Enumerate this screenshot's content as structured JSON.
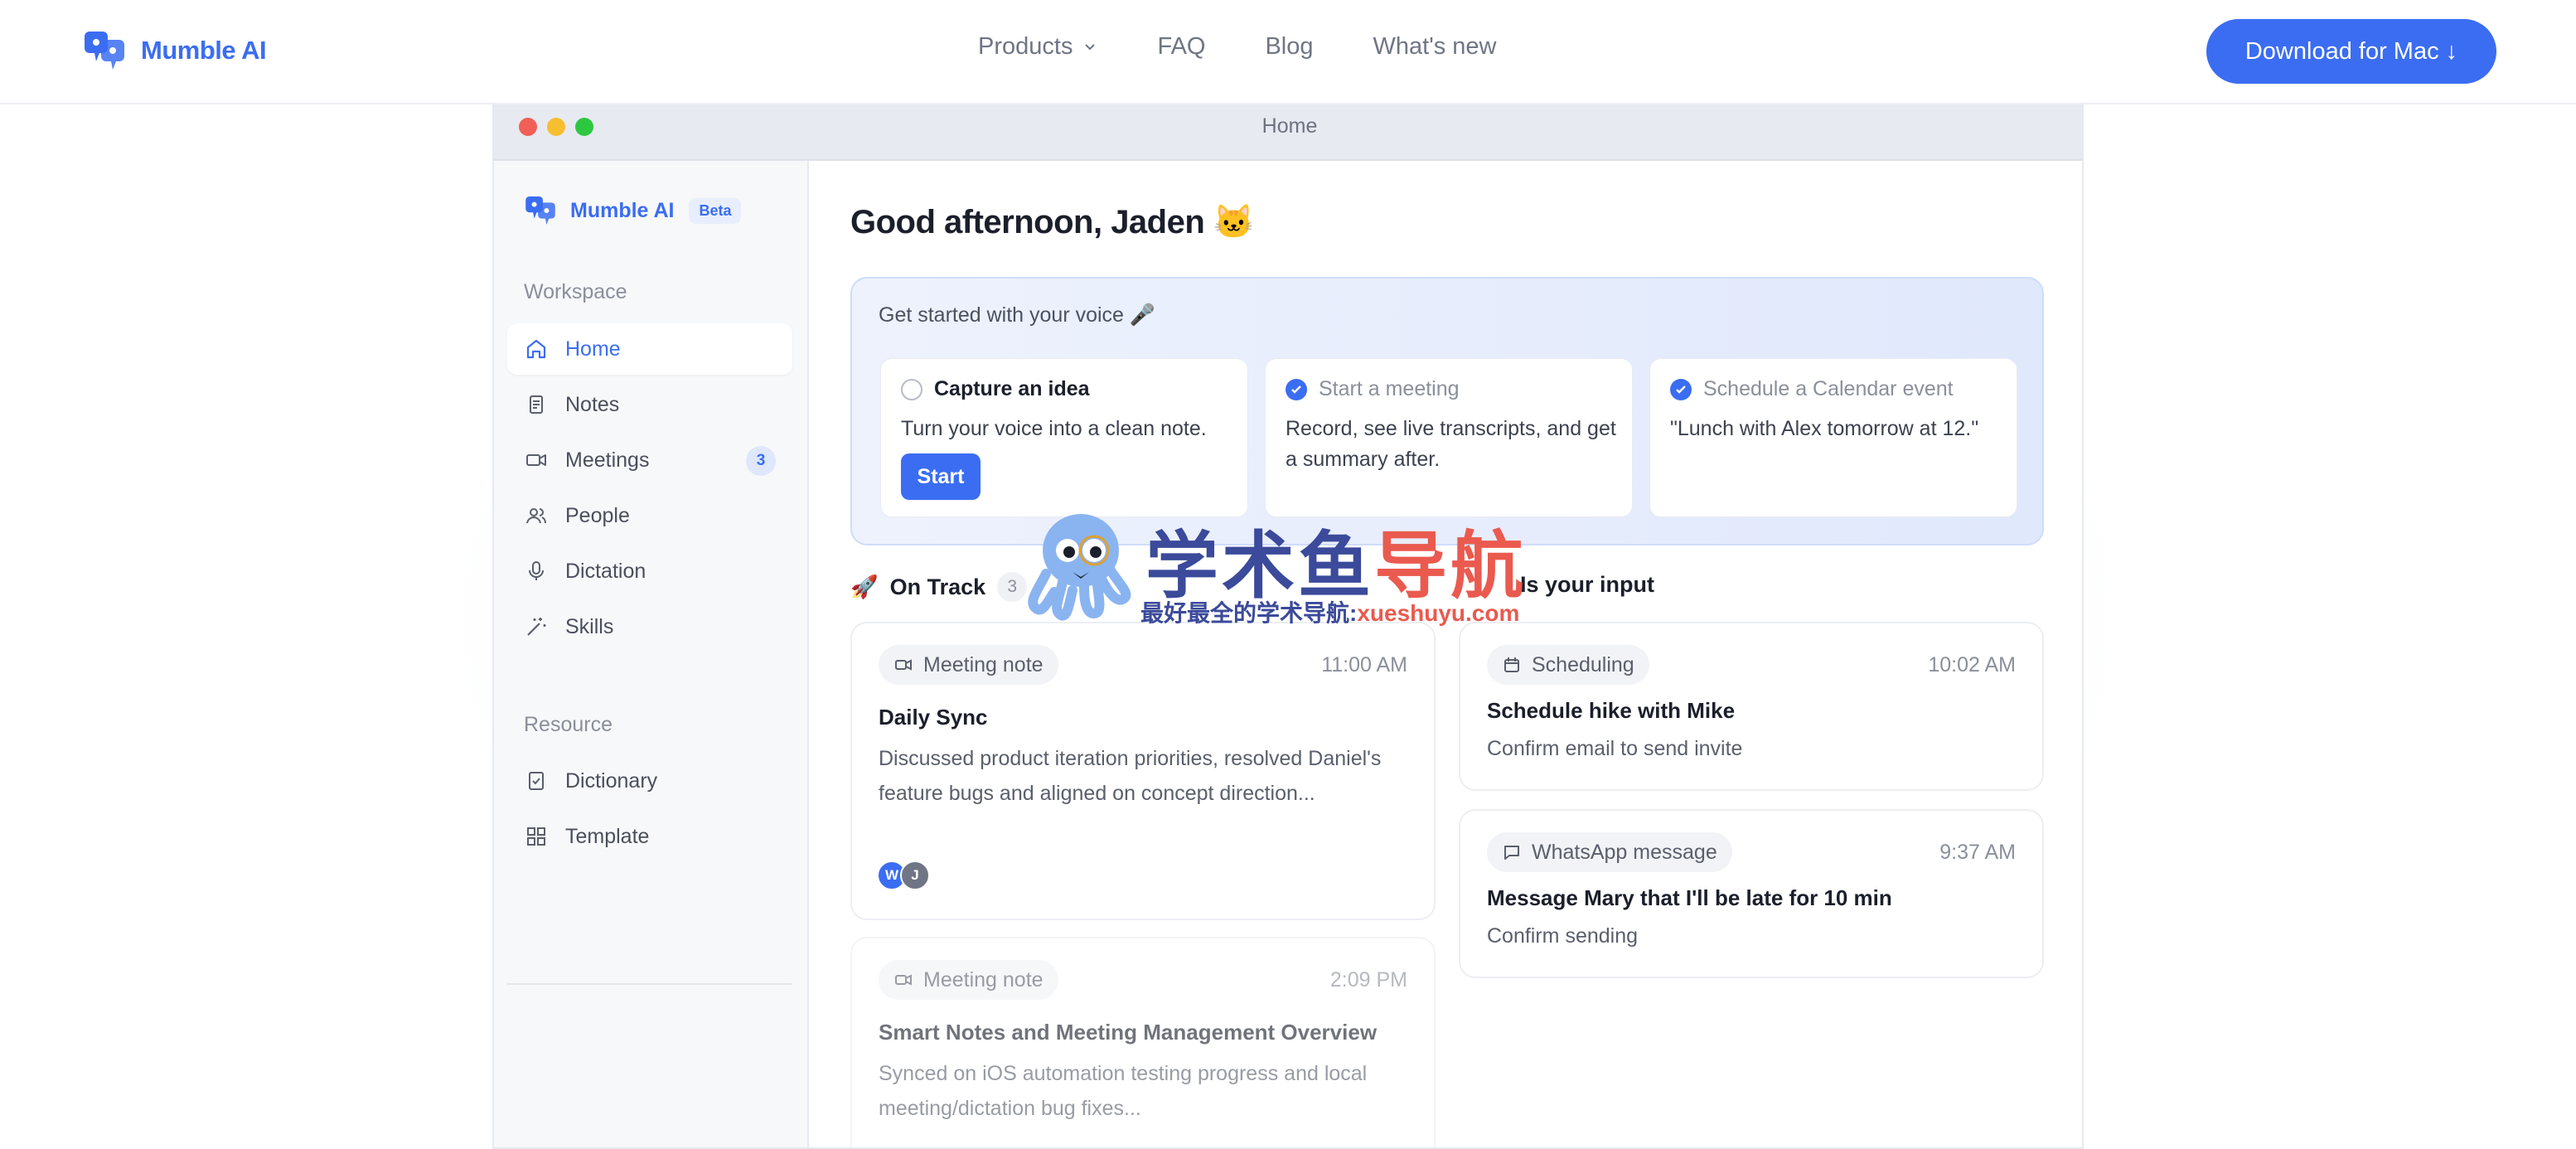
{
  "nav": {
    "brand": "Mumble AI",
    "products": "Products",
    "faq": "FAQ",
    "blog": "Blog",
    "whats_new": "What's new",
    "download": "Download for Mac ↓"
  },
  "window": {
    "title": "Home"
  },
  "sidebar": {
    "brand": "Mumble AI",
    "beta": "Beta",
    "workspace_label": "Workspace",
    "items": [
      {
        "label": "Home",
        "icon": "home-icon"
      },
      {
        "label": "Notes",
        "icon": "note-icon"
      },
      {
        "label": "Meetings",
        "icon": "video-icon",
        "badge": "3"
      },
      {
        "label": "People",
        "icon": "people-icon"
      },
      {
        "label": "Dictation",
        "icon": "microphone-icon"
      },
      {
        "label": "Skills",
        "icon": "magic-wand-icon"
      }
    ],
    "resource_label": "Resource",
    "resources": [
      {
        "label": "Dictionary",
        "icon": "dictionary-icon"
      },
      {
        "label": "Template",
        "icon": "grid-icon"
      }
    ]
  },
  "main": {
    "greeting": "Good afternoon, Jaden 🐱",
    "get_started": {
      "heading": "Get started with your voice 🎤",
      "cards": [
        {
          "title": "Capture an idea",
          "desc": "Turn your voice into a clean note.",
          "button": "Start",
          "done": false
        },
        {
          "title": "Start a meeting",
          "desc": "Record, see live transcripts, and get a summary after.",
          "done": true
        },
        {
          "title": "Schedule a Calendar event",
          "desc": "\"Lunch with Alex tomorrow at 12.\"",
          "done": true
        }
      ]
    },
    "on_track": {
      "emoji": "🚀",
      "label": "On Track",
      "count": "3",
      "items": [
        {
          "tag": "Meeting note",
          "time": "11:00 AM",
          "title": "Daily Sync",
          "desc": "Discussed product iteration priorities, resolved Daniel's feature bugs and aligned on concept direction...",
          "avatars": [
            "W",
            "J"
          ]
        },
        {
          "tag": "Meeting note",
          "time": "2:09 PM",
          "title": "Smart Notes and Meeting Management Overview",
          "desc": "Synced on iOS automation testing progress and local meeting/dictation bug fixes..."
        }
      ]
    },
    "needs_input": {
      "label": "Is your input",
      "items": [
        {
          "tag": "Scheduling",
          "time": "10:02 AM",
          "title": "Schedule hike with Mike",
          "desc": "Confirm email to send invite"
        },
        {
          "tag": "WhatsApp message",
          "time": "9:37 AM",
          "title": "Message Mary that I'll be late for 10 min",
          "desc": "Confirm sending"
        }
      ]
    }
  },
  "watermark": {
    "title_a": "学术鱼",
    "title_b": "导航",
    "sub_a": "最好最全的学术导航:",
    "sub_b": "xueshuyu.com"
  },
  "colors": {
    "accent": "#3b6df2",
    "sidebar_bg": "#f7f8fa",
    "titlebar_bg": "#e7eaf1"
  }
}
